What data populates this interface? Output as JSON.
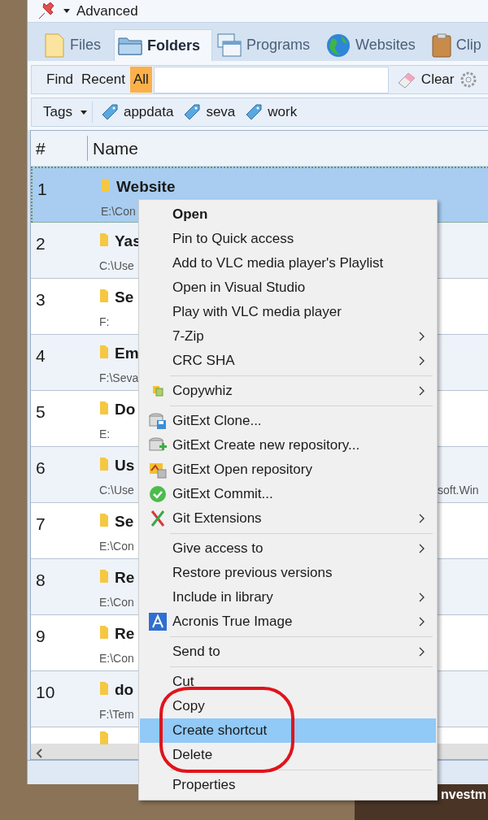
{
  "title_bar": {
    "title": "Advanced"
  },
  "tabs": [
    {
      "label": "Files",
      "kind": "file",
      "selected": false
    },
    {
      "label": "Folders",
      "kind": "folder",
      "selected": true
    },
    {
      "label": "Programs",
      "kind": "windows",
      "selected": false
    },
    {
      "label": "Websites",
      "kind": "globe",
      "selected": false
    },
    {
      "label": "Clip",
      "kind": "clipboard",
      "selected": false
    }
  ],
  "find_bar": {
    "modes": [
      {
        "label": "Find",
        "selected": false
      },
      {
        "label": "Recent",
        "selected": false
      },
      {
        "label": "All",
        "selected": true
      }
    ],
    "clear": "Clear"
  },
  "tags_bar": {
    "label": "Tags",
    "tags": [
      "appdata",
      "seva",
      "work"
    ]
  },
  "table": {
    "columns": [
      "#",
      "Name"
    ],
    "rows": [
      {
        "number": "1",
        "name": "Website",
        "path": "E:\\Con",
        "selected": true
      },
      {
        "number": "2",
        "name": "Yas",
        "path": "C:\\Use",
        "selected": false
      },
      {
        "number": "3",
        "name": "Se",
        "path": "F:",
        "selected": false
      },
      {
        "number": "4",
        "name": "Em",
        "path": "F:\\Seva",
        "selected": false
      },
      {
        "number": "5",
        "name": "Do",
        "path": "E:",
        "selected": false
      },
      {
        "number": "6",
        "name": "Us",
        "path": "C:\\Use",
        "path_end": "soft.Win",
        "selected": false
      },
      {
        "number": "7",
        "name": "Se",
        "path": "E:\\Con",
        "selected": false
      },
      {
        "number": "8",
        "name": "Re",
        "path": "E:\\Con",
        "selected": false
      },
      {
        "number": "9",
        "name": "Re",
        "path": "E:\\Con",
        "selected": false
      },
      {
        "number": "10",
        "name": "do",
        "path": "F:\\Tem",
        "selected": false
      }
    ]
  },
  "context_menu": [
    {
      "kind": "item",
      "label": "Open",
      "bold": true
    },
    {
      "kind": "item",
      "label": "Pin to Quick access"
    },
    {
      "kind": "item",
      "label": "Add to VLC media player's Playlist"
    },
    {
      "kind": "item",
      "label": "Open in Visual Studio"
    },
    {
      "kind": "item",
      "label": "Play with VLC media player"
    },
    {
      "kind": "item",
      "label": "7-Zip",
      "submenu": true
    },
    {
      "kind": "item",
      "label": "CRC SHA",
      "submenu": true
    },
    {
      "kind": "separator"
    },
    {
      "kind": "copies",
      "label": "Copywhiz",
      "submenu": true
    },
    {
      "kind": "separator"
    },
    {
      "kind": "disk",
      "label": "GitExt Clone..."
    },
    {
      "kind": "add",
      "label": "GitExt Create new repository..."
    },
    {
      "kind": "open",
      "label": "GitExt Open repository"
    },
    {
      "kind": "check",
      "label": "GitExt Commit..."
    },
    {
      "kind": "cross",
      "label": "Git Extensions",
      "submenu": true
    },
    {
      "kind": "separator"
    },
    {
      "kind": "item",
      "label": "Give access to",
      "submenu": true
    },
    {
      "kind": "item",
      "label": "Restore previous versions"
    },
    {
      "kind": "item",
      "label": "Include in library",
      "submenu": true
    },
    {
      "kind": "letter",
      "label": "Acronis True Image",
      "submenu": true
    },
    {
      "kind": "separator"
    },
    {
      "kind": "item",
      "label": "Send to",
      "submenu": true
    },
    {
      "kind": "separator"
    },
    {
      "kind": "item",
      "label": "Cut"
    },
    {
      "kind": "item",
      "label": "Copy"
    },
    {
      "kind": "item",
      "label": "Create shortcut",
      "selected": true
    },
    {
      "kind": "item",
      "label": "Delete"
    },
    {
      "kind": "separator"
    },
    {
      "kind": "item",
      "label": "Properties"
    }
  ],
  "desktop_thumbnail": {
    "caption": "nvestm"
  }
}
